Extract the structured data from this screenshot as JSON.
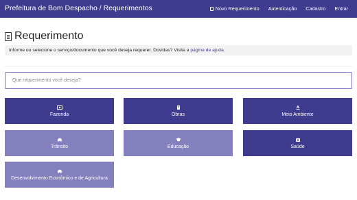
{
  "header": {
    "brand": "Prefeitura de Bom Despacho / Requerimentos",
    "links": [
      "Novo Requerimento",
      "Autenticação",
      "Cadastro",
      "Entrar"
    ]
  },
  "page": {
    "title": "Requerimento",
    "info_text": "Informe ou selecione o serviço/documento que você deseja requerer. Dúvidas? Visite a",
    "info_link": "página de ajuda",
    "info_end": "."
  },
  "search": {
    "placeholder": "Que requerimento você deseja?"
  },
  "services": [
    {
      "label": "Fazenda",
      "icon": "money-icon",
      "style": "dark"
    },
    {
      "label": "Obras",
      "icon": "building-icon",
      "style": "dark"
    },
    {
      "label": "Meio Ambiente",
      "icon": "recycle-icon",
      "style": "dark"
    },
    {
      "label": "Trânsito",
      "icon": "car-icon",
      "style": "light"
    },
    {
      "label": "Educação",
      "icon": "graduation-cap-icon",
      "style": "light"
    },
    {
      "label": "Saúde",
      "icon": "medkit-icon",
      "style": "dark"
    },
    {
      "label": "Desenvolvimento Econômico e de Agricultura",
      "icon": "car-icon",
      "style": "light"
    }
  ]
}
